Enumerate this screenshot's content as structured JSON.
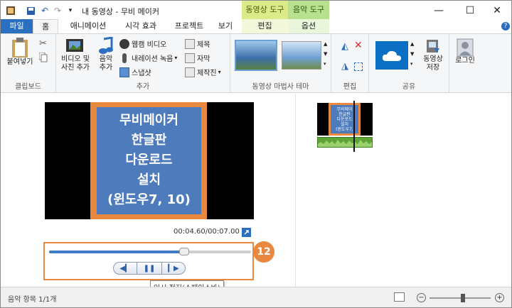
{
  "title_bar": {
    "title": "내 동영상 - 무비 메이커",
    "context_video_tools": "동영상 도구",
    "context_audio_tools": "음악 도구"
  },
  "tabs": [
    {
      "label": "파일"
    },
    {
      "label": "홈"
    },
    {
      "label": "애니메이션"
    },
    {
      "label": "시각 효과"
    },
    {
      "label": "프로젝트"
    },
    {
      "label": "보기"
    },
    {
      "label": "편집"
    },
    {
      "label": "옵션"
    }
  ],
  "ribbon": {
    "clipboard": {
      "paste_label": "붙여넣기",
      "group_label": "클립보드"
    },
    "add": {
      "video_photo_line1": "비디오 및",
      "video_photo_line2": "사진 추가",
      "music_line1": "음악",
      "music_line2": "추가",
      "webcam": "웹캠 비디오",
      "narration": "내레이션 녹음",
      "snapshot": "스냅샷",
      "title": "제목",
      "caption": "자막",
      "credits": "제작진",
      "group_label": "추가"
    },
    "themes": {
      "group_label": "동영상 마법사 테마"
    },
    "edit": {
      "group_label": "편집"
    },
    "share": {
      "save_line1": "동영상",
      "save_line2": "저장",
      "group_label": "공유"
    },
    "signin": {
      "label": "로그인"
    }
  },
  "preview": {
    "thumbnail_lines": [
      "무비메이커",
      "한글판",
      "다운로드",
      "설치",
      "(윈도우7, 10)"
    ],
    "time": "00:04.60/00:07.00",
    "seek_progress": 0.67,
    "step_badge": "12",
    "tooltip": "일시 정지(스페이스바)"
  },
  "storyboard": {
    "clip_lines": [
      "무비메이",
      "한글판",
      "다운로드",
      "설치",
      "(윈도우7,"
    ]
  },
  "status": {
    "text": "음악 항목 1/1개",
    "zoom": 0.55
  },
  "colors": {
    "accent": "#2b6fbf",
    "highlight": "#e8893f",
    "slide": "#4d7bbc"
  }
}
